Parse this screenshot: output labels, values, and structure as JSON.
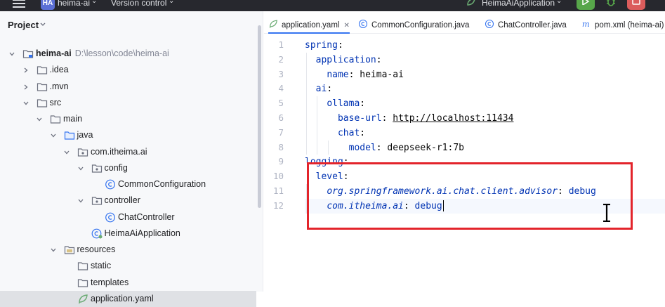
{
  "titlebar": {
    "project_initials": "HA",
    "project_name": "heima-ai",
    "vcs_label": "Version control",
    "run_config": "HeimaAiApplication"
  },
  "project_panel": {
    "title": "Project",
    "tree": [
      {
        "label": "heima-ai",
        "path": "D:\\lesson\\code\\heima-ai",
        "depth": 0,
        "expanded": true,
        "icon": "module-folder-icon",
        "bold": true
      },
      {
        "label": ".idea",
        "depth": 1,
        "expanded": false,
        "icon": "folder-icon"
      },
      {
        "label": ".mvn",
        "depth": 1,
        "expanded": false,
        "icon": "folder-icon"
      },
      {
        "label": "src",
        "depth": 1,
        "expanded": true,
        "icon": "folder-icon"
      },
      {
        "label": "main",
        "depth": 2,
        "expanded": true,
        "icon": "folder-icon"
      },
      {
        "label": "java",
        "depth": 3,
        "expanded": true,
        "icon": "source-folder-icon"
      },
      {
        "label": "com.itheima.ai",
        "depth": 4,
        "expanded": true,
        "icon": "package-icon"
      },
      {
        "label": "config",
        "depth": 5,
        "expanded": true,
        "icon": "package-icon"
      },
      {
        "label": "CommonConfiguration",
        "depth": 6,
        "icon": "class-icon"
      },
      {
        "label": "controller",
        "depth": 5,
        "expanded": true,
        "icon": "package-icon"
      },
      {
        "label": "ChatController",
        "depth": 6,
        "icon": "class-icon"
      },
      {
        "label": "HeimaAiApplication",
        "depth": 5,
        "icon": "spring-class-icon"
      },
      {
        "label": "resources",
        "depth": 3,
        "expanded": true,
        "icon": "resources-folder-icon"
      },
      {
        "label": "static",
        "depth": 4,
        "icon": "folder-icon"
      },
      {
        "label": "templates",
        "depth": 4,
        "icon": "folder-icon"
      },
      {
        "label": "application.yaml",
        "depth": 4,
        "icon": "yaml-icon",
        "selected": true
      }
    ]
  },
  "tabs": [
    {
      "label": "application.yaml",
      "icon": "yaml-icon",
      "active": true
    },
    {
      "label": "CommonConfiguration.java",
      "icon": "class-icon"
    },
    {
      "label": "ChatController.java",
      "icon": "class-icon"
    },
    {
      "label": "pom.xml (heima-ai)",
      "icon": "maven-icon"
    }
  ],
  "editor": {
    "lines": [
      {
        "n": "1",
        "indent": "",
        "key": "spring",
        "sep": ":",
        "value": "",
        "style": "key"
      },
      {
        "n": "2",
        "indent": "  ",
        "key": "application",
        "sep": ":",
        "value": "",
        "style": "key"
      },
      {
        "n": "3",
        "indent": "    ",
        "key": "name",
        "sep": ": ",
        "value": "heima-ai",
        "style": "key"
      },
      {
        "n": "4",
        "indent": "  ",
        "key": "ai",
        "sep": ":",
        "value": "",
        "style": "key"
      },
      {
        "n": "5",
        "indent": "    ",
        "key": "ollama",
        "sep": ":",
        "value": "",
        "style": "key"
      },
      {
        "n": "6",
        "indent": "      ",
        "key": "base-url",
        "sep": ": ",
        "value": "http://localhost:11434",
        "style": "url"
      },
      {
        "n": "7",
        "indent": "      ",
        "key": "chat",
        "sep": ":",
        "value": "",
        "style": "key"
      },
      {
        "n": "8",
        "indent": "        ",
        "key": "model",
        "sep": ": ",
        "value": "deepseek-r1:7b",
        "style": "key"
      },
      {
        "n": "9",
        "indent": "",
        "key": "logging",
        "sep": ":",
        "value": "",
        "style": "key"
      },
      {
        "n": "10",
        "indent": "  ",
        "key": "level",
        "sep": ":",
        "value": "",
        "style": "key"
      },
      {
        "n": "11",
        "indent": "    ",
        "key": "org.springframework.ai.chat.client.advisor",
        "sep": ": ",
        "value": "debug",
        "style": "italic"
      },
      {
        "n": "12",
        "indent": "    ",
        "key": "com.itheima.ai",
        "sep": ": ",
        "value": "debug",
        "style": "italic",
        "current": true
      }
    ]
  }
}
